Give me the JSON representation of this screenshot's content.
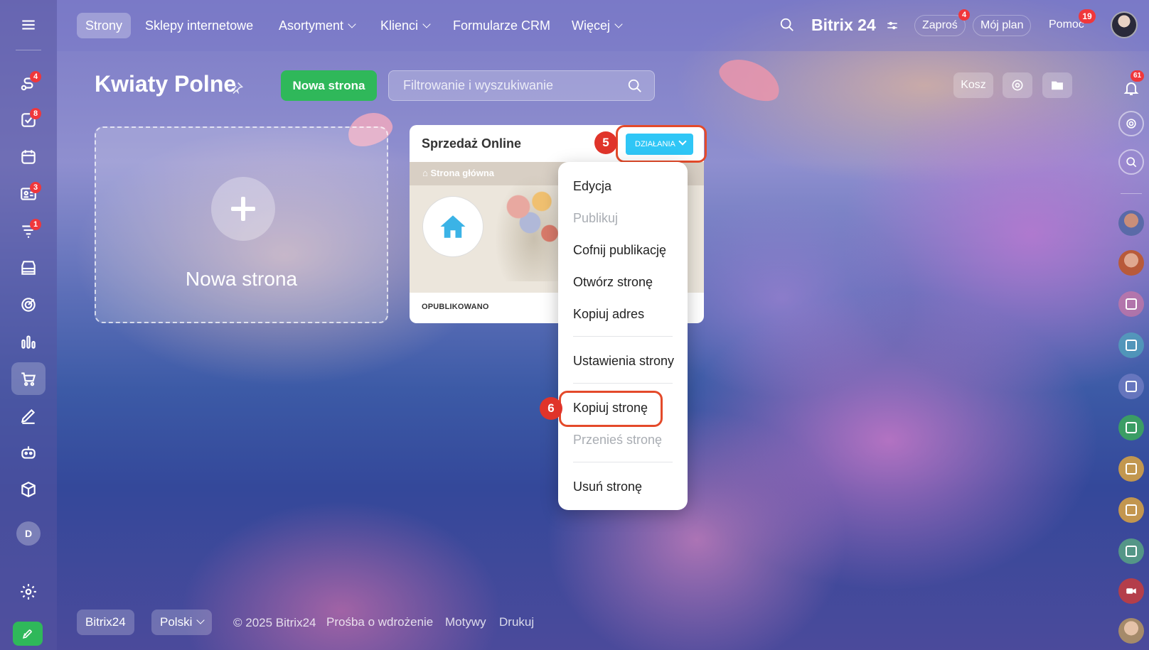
{
  "topbar": {
    "nav": [
      {
        "label": "Strony"
      },
      {
        "label": "Sklepy internetowe"
      },
      {
        "label": "Asortyment"
      },
      {
        "label": "Klienci"
      },
      {
        "label": "Formularze CRM"
      },
      {
        "label": "Więcej"
      }
    ],
    "logo": "Bitrix 24",
    "invite_label": "Zaproś",
    "invite_badge": "4",
    "plan_label": "Mój plan",
    "help_label": "Pomoc",
    "help_badge": "19"
  },
  "sidebar": {
    "badges": {
      "routes": "4",
      "tasks": "8",
      "crm": "3",
      "funnel": "1"
    },
    "user_initial": "D"
  },
  "page": {
    "title": "Kwiaty Polne",
    "new_button": "Nowa strona",
    "search_placeholder": "Filtrowanie i wyszukiwanie",
    "trash_label": "Kosz"
  },
  "new_card": {
    "label": "Nowa strona"
  },
  "site_card": {
    "title": "Sprzedaż Online",
    "actions_label": "DZIAŁANIA",
    "preview_tag": "Strona główna",
    "status": "OPUBLIKOWANO"
  },
  "menu": {
    "items": [
      {
        "label": "Edycja",
        "disabled": false
      },
      {
        "label": "Publikuj",
        "disabled": true
      },
      {
        "label": "Cofnij publikację",
        "disabled": false
      },
      {
        "label": "Otwórz stronę",
        "disabled": false
      },
      {
        "label": "Kopiuj adres",
        "disabled": false
      },
      {
        "label": "Ustawienia strony",
        "disabled": false
      },
      {
        "label": "Kopiuj stronę",
        "disabled": false
      },
      {
        "label": "Przenieś stronę",
        "disabled": true
      },
      {
        "label": "Usuń stronę",
        "disabled": false
      }
    ]
  },
  "markers": {
    "step5": "5",
    "step6": "6"
  },
  "right_sidebar": {
    "notifications_badge": "61"
  },
  "footer": {
    "brand": "Bitrix24",
    "language": "Polski",
    "copyright": "© 2025 Bitrix24",
    "links": [
      "Prośba o wdrożenie",
      "Motywy",
      "Drukuj"
    ]
  },
  "colors": {
    "accent_green": "#2fb85a",
    "actions_blue": "#2fc6f6",
    "marker_red": "#e0342a",
    "badge_red": "#f0373b"
  }
}
